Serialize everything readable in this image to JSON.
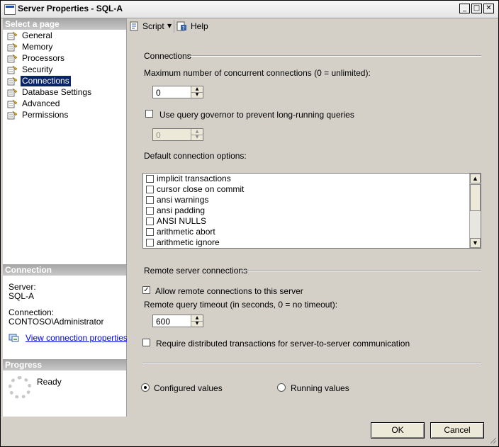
{
  "window": {
    "title": "Server Properties - SQL-A",
    "minimize_glyph": "_",
    "maximize_glyph": "□",
    "close_glyph": "✕"
  },
  "left": {
    "select_page_header": "Select a page",
    "pages": [
      {
        "label": "General",
        "icon": "page-settings-icon"
      },
      {
        "label": "Memory",
        "icon": "page-settings-icon"
      },
      {
        "label": "Processors",
        "icon": "page-settings-icon"
      },
      {
        "label": "Security",
        "icon": "page-settings-icon"
      },
      {
        "label": "Connections",
        "icon": "page-settings-icon"
      },
      {
        "label": "Database Settings",
        "icon": "page-settings-icon"
      },
      {
        "label": "Advanced",
        "icon": "page-settings-icon"
      },
      {
        "label": "Permissions",
        "icon": "page-settings-icon"
      }
    ],
    "selected_page": "Connections",
    "connection_header": "Connection",
    "server_label": "Server:",
    "server_value": "SQL-A",
    "connection_label": "Connection:",
    "connection_value": "CONTOSO\\Administrator",
    "view_connection_link": "View connection properties",
    "progress_header": "Progress",
    "progress_status": "Ready"
  },
  "toolbar": {
    "script_label": "Script",
    "help_label": "Help"
  },
  "connections": {
    "section_title": "Connections",
    "max_conn_label": "Maximum number of concurrent connections (0 = unlimited):",
    "max_conn_value": "0",
    "governor_label": "Use query governor to prevent long-running queries",
    "governor_checked": false,
    "governor_value": "0",
    "default_options_label": "Default connection options:",
    "options": [
      {
        "label": "implicit transactions",
        "checked": false
      },
      {
        "label": "cursor close on commit",
        "checked": false
      },
      {
        "label": "ansi warnings",
        "checked": false
      },
      {
        "label": "ansi padding",
        "checked": false
      },
      {
        "label": "ANSI NULLS",
        "checked": false
      },
      {
        "label": "arithmetic abort",
        "checked": false
      },
      {
        "label": "arithmetic ignore",
        "checked": false
      }
    ]
  },
  "remote": {
    "section_title": "Remote server connections",
    "allow_label": "Allow remote connections to this server",
    "allow_checked": true,
    "timeout_label": "Remote query timeout (in seconds, 0 = no timeout):",
    "timeout_value": "600",
    "require_dtc_label": "Require distributed transactions for server-to-server communication",
    "require_dtc_checked": false
  },
  "values_mode": {
    "configured_label": "Configured values",
    "running_label": "Running values",
    "selected": "configured"
  },
  "buttons": {
    "ok_label": "OK",
    "cancel_label": "Cancel"
  },
  "colors": {
    "selection": "#0a246a",
    "panel": "#d4d0c8",
    "link": "#0000ee"
  }
}
